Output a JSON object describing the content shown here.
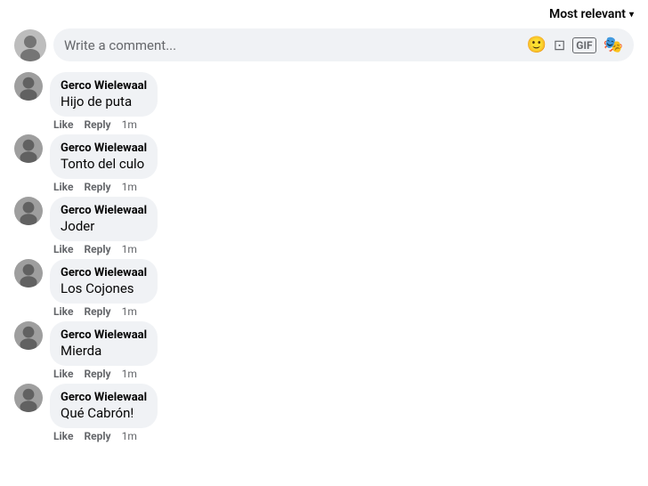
{
  "header": {
    "sort_label": "Most relevant",
    "chevron": "▾"
  },
  "comment_input": {
    "placeholder": "Write a comment...",
    "icons": [
      "😊",
      "📷",
      "GIF",
      "🎭"
    ]
  },
  "comments": [
    {
      "id": 1,
      "author": "Gerco Wielewaal",
      "text": "Hijo de puta",
      "like": "Like",
      "reply": "Reply",
      "time": "1m"
    },
    {
      "id": 2,
      "author": "Gerco Wielewaal",
      "text": "Tonto del culo",
      "like": "Like",
      "reply": "Reply",
      "time": "1m"
    },
    {
      "id": 3,
      "author": "Gerco Wielewaal",
      "text": "Joder",
      "like": "Like",
      "reply": "Reply",
      "time": "1m"
    },
    {
      "id": 4,
      "author": "Gerco Wielewaal",
      "text": "Los Cojones",
      "like": "Like",
      "reply": "Reply",
      "time": "1m"
    },
    {
      "id": 5,
      "author": "Gerco Wielewaal",
      "text": "Mierda",
      "like": "Like",
      "reply": "Reply",
      "time": "1m"
    },
    {
      "id": 6,
      "author": "Gerco Wielewaal",
      "text": "Qué Cabrón!",
      "like": "Like",
      "reply": "Reply",
      "time": "1m"
    }
  ]
}
